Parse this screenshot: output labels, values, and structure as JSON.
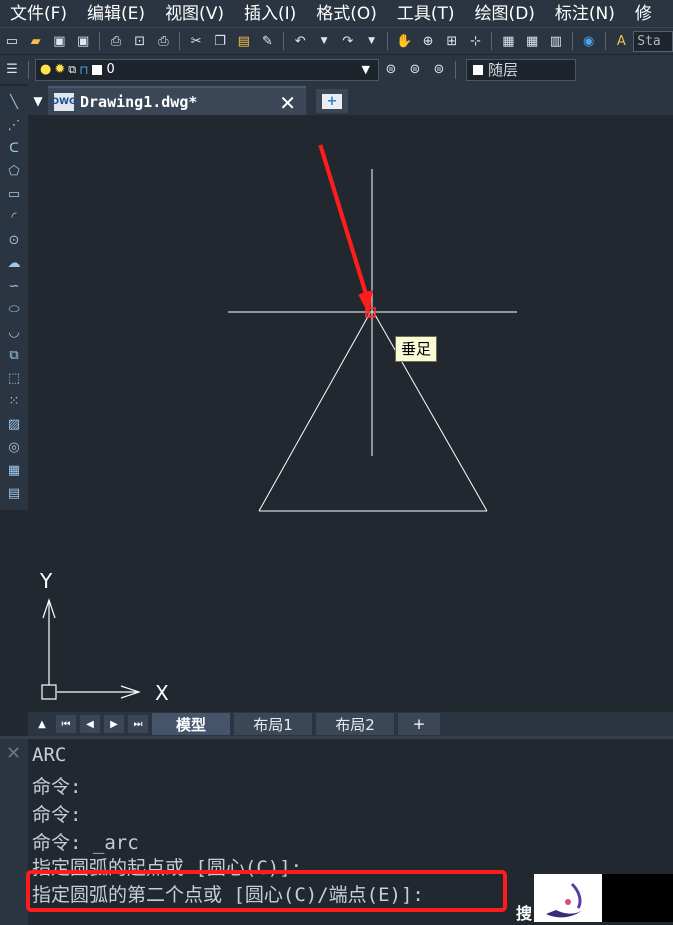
{
  "menu": [
    "文件(F)",
    "编辑(E)",
    "视图(V)",
    "插入(I)",
    "格式(O)",
    "工具(T)",
    "绘图(D)",
    "标注(N)",
    "修"
  ],
  "toolbar": {
    "text_style": "Sta",
    "layer_name": "0",
    "color_label": "随层"
  },
  "document_tab": {
    "title": "Drawing1.dwg*",
    "icon_text": "DWG"
  },
  "canvas": {
    "tooltip": "垂足",
    "axis_y": "Y",
    "axis_x": "X",
    "line_color": "#ffffff",
    "arrow_color": "#ff1c1c"
  },
  "layout_tabs": {
    "model": "模型",
    "layout1": "布局1",
    "layout2": "布局2",
    "add": "+"
  },
  "command": {
    "lines": [
      "ARC",
      "命令:",
      "命令:",
      "命令: _arc",
      "指定圆弧的起点或 [圆心(C)]:",
      "指定圆弧的第二个点或 [圆心(C)/端点(E)]:"
    ],
    "highlight_color": "#ff1c1c"
  },
  "watermark": {
    "text": "搜"
  }
}
